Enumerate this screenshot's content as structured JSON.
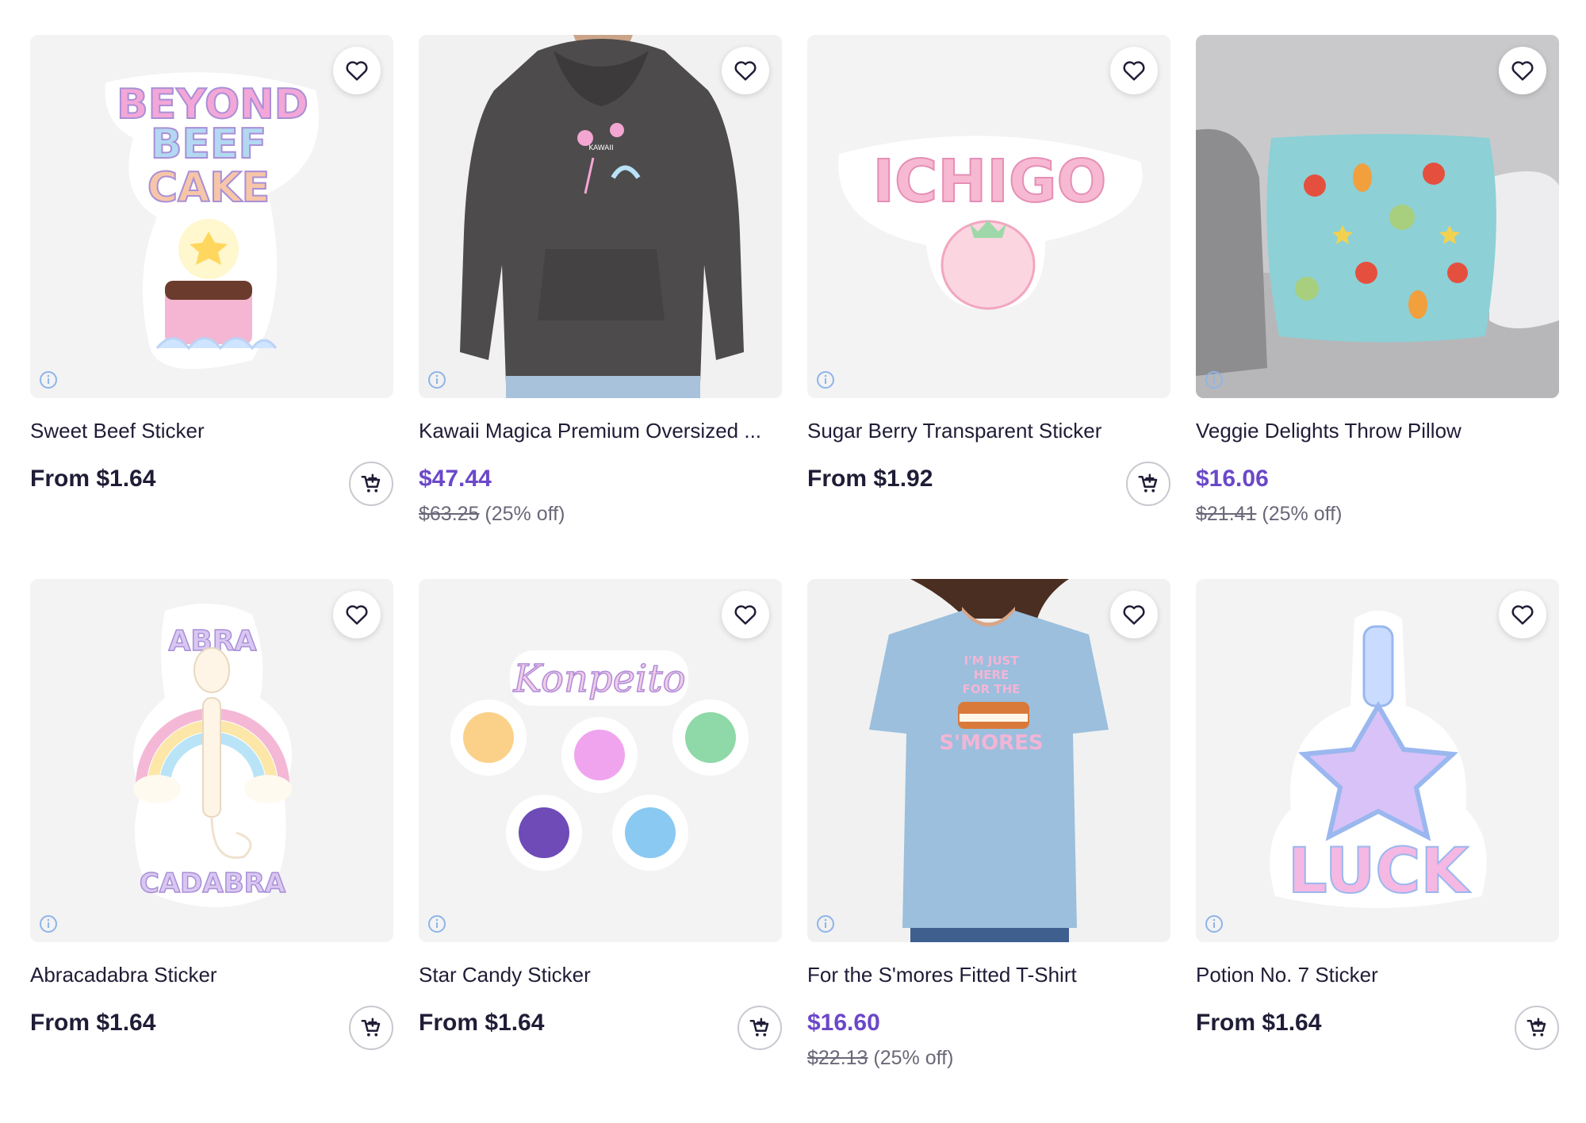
{
  "products": [
    {
      "title": "Sweet Beef Sticker",
      "price": "From $1.64",
      "sale": false,
      "has_cart": true,
      "art": "beyond-beef-cake-sticker",
      "art_text": [
        "BEYOND",
        "BEEF",
        "CAKE"
      ]
    },
    {
      "title": "Kawaii Magica Premium Oversized ...",
      "price": "$47.44",
      "sale": true,
      "was_price": "$63.25",
      "discount": "(25% off)",
      "has_cart": false,
      "art": "gray-hoodie",
      "art_text": [
        "KAWAII"
      ]
    },
    {
      "title": "Sugar Berry Transparent Sticker",
      "price": "From $1.92",
      "sale": false,
      "has_cart": true,
      "art": "ichigo-strawberry-sticker",
      "art_text": [
        "ICHIGO"
      ]
    },
    {
      "title": "Veggie Delights Throw Pillow",
      "price": "$16.06",
      "sale": true,
      "was_price": "$21.41",
      "discount": "(25% off)",
      "has_cart": false,
      "art": "veggie-pillow",
      "art_text": []
    },
    {
      "title": "Abracadabra Sticker",
      "price": "From $1.64",
      "sale": false,
      "has_cart": true,
      "art": "abracadabra-sticker",
      "art_text": [
        "ABRA",
        "CADABRA"
      ]
    },
    {
      "title": "Star Candy Sticker",
      "price": "From $1.64",
      "sale": false,
      "has_cart": true,
      "art": "konpeito-sticker",
      "art_text": [
        "Konpeito"
      ]
    },
    {
      "title": "For the S'mores Fitted T-Shirt",
      "price": "$16.60",
      "sale": true,
      "was_price": "$22.13",
      "discount": "(25% off)",
      "has_cart": false,
      "art": "smores-tshirt",
      "art_text": [
        "I'M JUST",
        "HERE",
        "FOR THE",
        "S'MORES"
      ]
    },
    {
      "title": "Potion No. 7 Sticker",
      "price": "From $1.64",
      "sale": false,
      "has_cart": true,
      "art": "luck-potion-sticker",
      "art_text": [
        "LUCK"
      ]
    }
  ],
  "icons": {
    "favorite": "heart-outline-icon",
    "info": "info-circle-icon",
    "add_to_cart": "cart-plus-icon"
  },
  "colors": {
    "sale_price": "#6b48c9",
    "text": "#1f1d36",
    "muted": "#6a6878",
    "thumb_bg": "#f3f3f4"
  }
}
